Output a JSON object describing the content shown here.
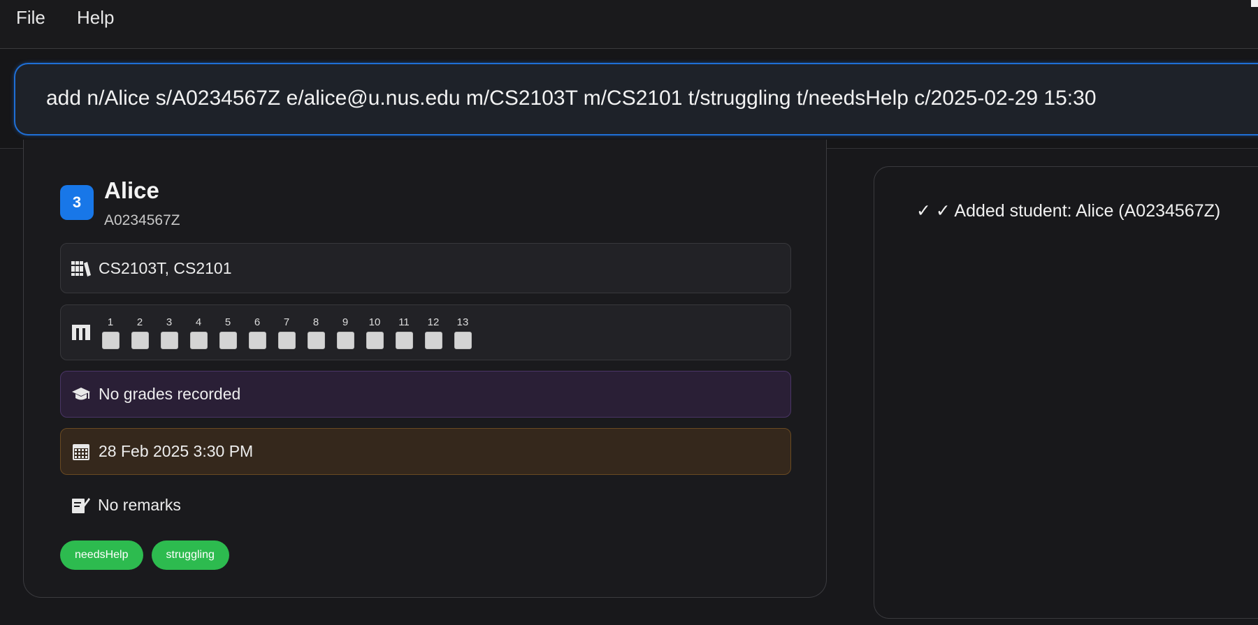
{
  "menu": {
    "file_label": "File",
    "help_label": "Help"
  },
  "command": {
    "value": "add n/Alice s/A0234567Z e/alice@u.nus.edu m/CS2103T m/CS2101 t/struggling t/needsHelp c/2025-02-29 15:30"
  },
  "student_card": {
    "index": "3",
    "name": "Alice",
    "student_id": "A0234567Z",
    "modules": "CS2103T, CS2101",
    "weeks": [
      "1",
      "2",
      "3",
      "4",
      "5",
      "6",
      "7",
      "8",
      "9",
      "10",
      "11",
      "12",
      "13"
    ],
    "grades": "No grades recorded",
    "consultation": "28 Feb 2025 3:30 PM",
    "remarks": "No remarks",
    "tags": [
      "needsHelp",
      "struggling"
    ],
    "colors": {
      "badge": "#1877e8",
      "tag": "#2dbb4f",
      "grades_bg": "#2a1f36",
      "consult_bg": "#35281c"
    },
    "icons": {
      "modules": "books-icon",
      "weeks": "attendance-icon",
      "grades": "graduation-cap-icon",
      "consultation": "calendar-icon",
      "remarks": "memo-icon"
    }
  },
  "result": {
    "message": "✓ ✓ Added student: Alice (A0234567Z)"
  }
}
